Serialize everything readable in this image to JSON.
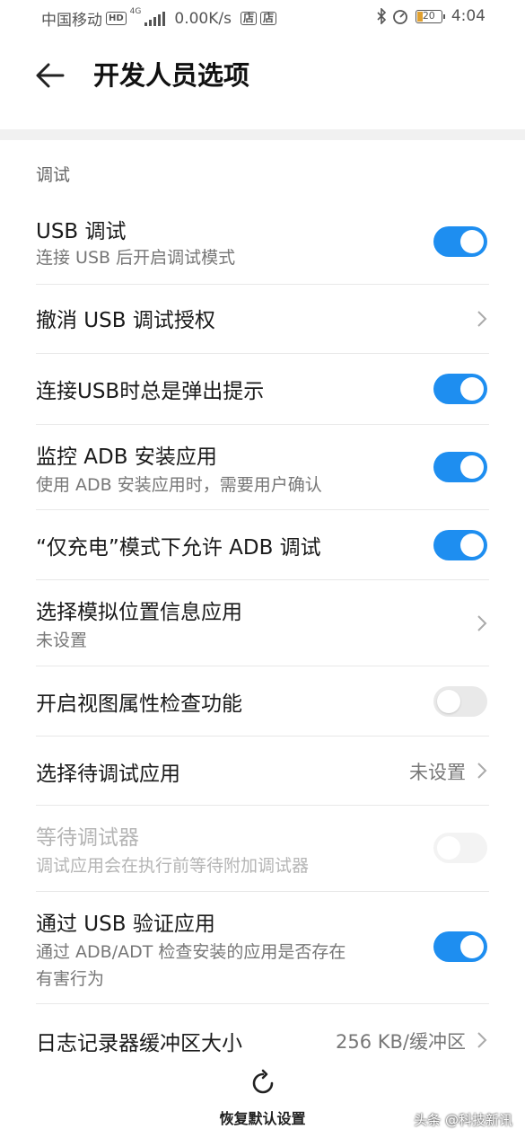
{
  "status_bar": {
    "carrier": "中国移动",
    "hd": "HD",
    "net": "4G",
    "speed": "0.00K/s",
    "store1": "店",
    "store2": "店",
    "battery": "20",
    "time": "4:04"
  },
  "header": {
    "title": "开发人员选项"
  },
  "section": {
    "label": "调试"
  },
  "rows": [
    {
      "title": "USB 调试",
      "subtitle": "连接 USB 后开启调试模式",
      "toggle": true
    },
    {
      "title": "撤消 USB 调试授权"
    },
    {
      "title": "连接USB时总是弹出提示",
      "toggle": true
    },
    {
      "title": "监控 ADB 安装应用",
      "subtitle": "使用 ADB 安装应用时，需要用户确认",
      "toggle": true
    },
    {
      "title": "“仅充电”模式下允许 ADB 调试",
      "toggle": true
    },
    {
      "title": "选择模拟位置信息应用",
      "subtitle": "未设置"
    },
    {
      "title": "开启视图属性检查功能",
      "toggle": false
    },
    {
      "title": "选择待调试应用",
      "value": "未设置"
    },
    {
      "title": "等待调试器",
      "subtitle": "调试应用会在执行前等待附加调试器",
      "toggle": false,
      "disabled": true
    },
    {
      "title": "通过 USB 验证应用",
      "subtitle_line1": "通过 ADB/ADT 检查安装的应用是否存在",
      "subtitle_line2": "有害行为",
      "toggle": true
    },
    {
      "title": "日志记录器缓冲区大小",
      "value": "256 KB/缓冲区"
    }
  ],
  "footer": {
    "restore_label": "恢复默认设置"
  },
  "watermark": "头条 @科技新讯",
  "colors": {
    "accent": "#1e8ef0",
    "toggle_off": "#e9e9e9"
  }
}
